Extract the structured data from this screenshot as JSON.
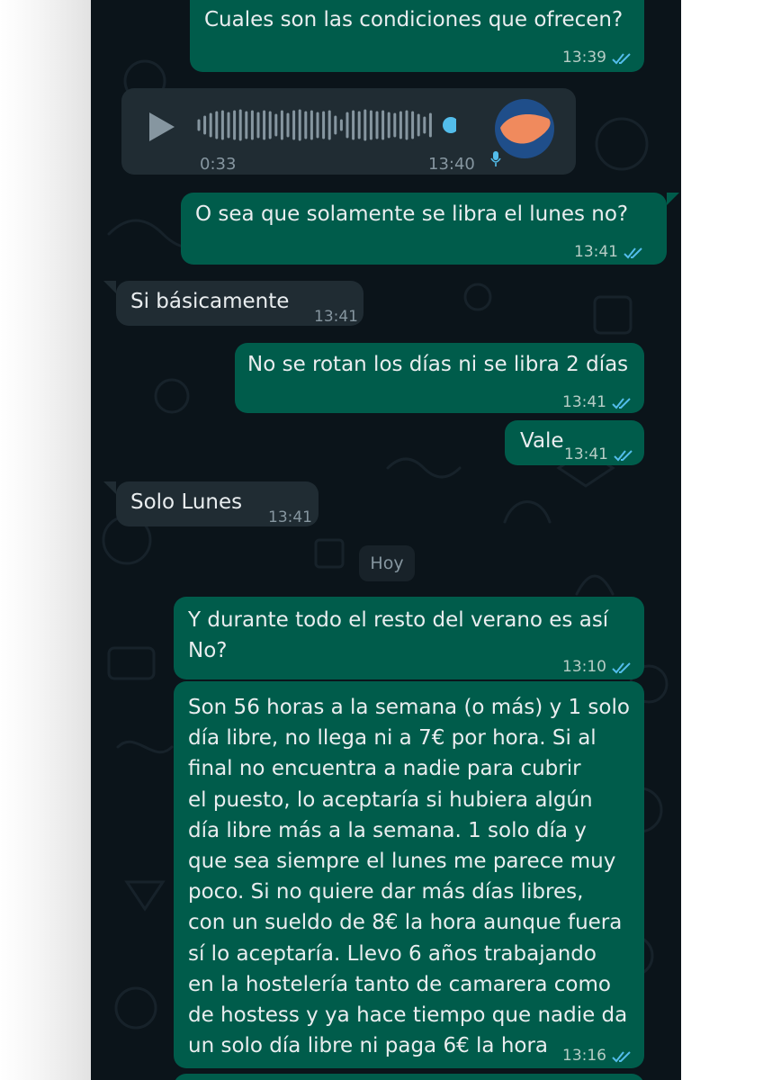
{
  "chat": {
    "messages": [
      {
        "id": "m1",
        "direction": "outgoing",
        "text": "Cuales son las condiciones que ofrecen?",
        "time": "13:39",
        "status": "read"
      },
      {
        "id": "m2",
        "direction": "incoming",
        "type": "voice_note",
        "duration": "0:33",
        "time": "13:40"
      },
      {
        "id": "m3",
        "direction": "outgoing",
        "text": "O sea que solamente se libra el lunes no?",
        "time": "13:41",
        "status": "read"
      },
      {
        "id": "m4",
        "direction": "incoming",
        "text": "Si básicamente",
        "time": "13:41"
      },
      {
        "id": "m5",
        "direction": "outgoing",
        "text": "No se rotan los días ni se libra 2 días",
        "time": "13:41",
        "status": "read"
      },
      {
        "id": "m6",
        "direction": "outgoing",
        "text": "Vale",
        "time": "13:41",
        "status": "read"
      },
      {
        "id": "m7",
        "direction": "incoming",
        "text": "Solo Lunes",
        "time": "13:41"
      },
      {
        "id": "m8",
        "direction": "outgoing",
        "lines": [
          "Y durante todo el resto del verano es así",
          "No?"
        ],
        "time": "13:10",
        "status": "read"
      },
      {
        "id": "m9",
        "direction": "outgoing",
        "lines": [
          "Son 56 horas a la semana (o más) y 1 solo",
          "día libre, no llega ni a 7€ por hora. Si al",
          "final no encuentra a nadie para cubrir",
          "el puesto, lo aceptaría si hubiera algún",
          "día libre más a la semana. 1 solo día y",
          "que sea siempre el lunes me parece muy",
          "poco. Si no quiere dar más días libres,",
          "con un sueldo de 8€ la hora aunque fuera",
          "sí lo aceptaría. Llevo 6 años trabajando",
          "en la hostelería tanto de camarera como",
          "de hostess y ya hace tiempo que nadie da",
          "un solo día libre ni paga 6€ la hora"
        ],
        "time": "13:16",
        "status": "read"
      }
    ],
    "day_separator": "Hoy"
  },
  "colors": {
    "chat_background": "#0b141a",
    "outgoing_bubble": "#005c4b",
    "incoming_bubble": "#202c33",
    "read_ticks": "#53bdeb",
    "avatar_redaction": "#f08a5d",
    "avatar_ring": "#1f4e8a"
  },
  "icons": [
    "play-icon",
    "voice-waveform",
    "microphone-icon",
    "read-receipt-icon"
  ]
}
